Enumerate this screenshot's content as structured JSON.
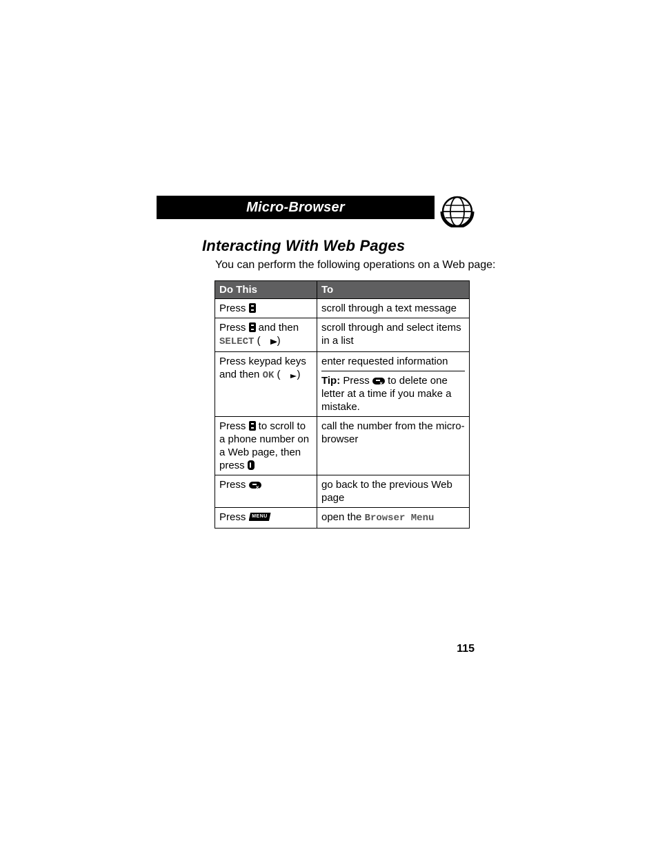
{
  "header": {
    "title": "Micro-Browser"
  },
  "section": {
    "heading": "Interacting With Web Pages",
    "intro": "You can perform the following operations on a Web page:"
  },
  "table": {
    "cols": {
      "action": "Do This",
      "result": "To"
    },
    "rows": [
      {
        "action_pre": "Press ",
        "result": "scroll through a text message"
      },
      {
        "action_pre": "Press ",
        "action_mid": " and then ",
        "action_select": "SELECT",
        "action_paren_open": " (",
        "action_paren_close": ")",
        "result": "scroll through and select items in a list"
      },
      {
        "action_line1": "Press keypad keys",
        "action_line2_pre": "and then ",
        "action_ok": "OK",
        "action_paren_open": " (",
        "action_paren_close": ")",
        "result_main": "enter requested information",
        "tip_label": "Tip:",
        "tip_pre": " Press ",
        "tip_post": " to delete one letter at a time if you make a mistake."
      },
      {
        "action_pre": "Press ",
        "action_mid": " to scroll to a phone number on a Web page, then press ",
        "result": "call the number from the micro-browser"
      },
      {
        "action_pre": "Press ",
        "result": "go back to the previous Web page"
      },
      {
        "action_pre": "Press ",
        "menu_label": "MENU",
        "result_pre": "open the ",
        "result_code": "Browser Menu"
      }
    ]
  },
  "page_number": "115"
}
